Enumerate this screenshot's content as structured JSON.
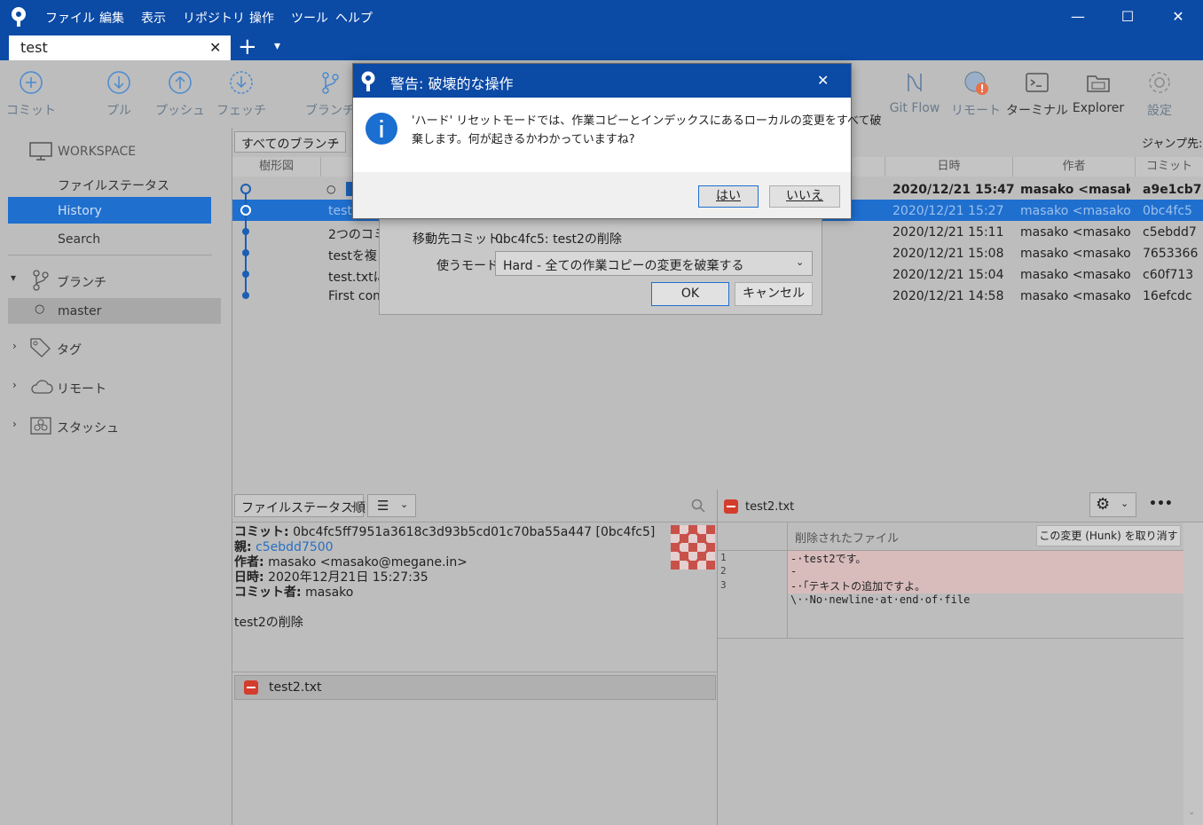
{
  "menubar": {
    "items": [
      "ファイル",
      "編集",
      "表示",
      "リポジトリ",
      "操作",
      "ツール",
      "ヘルプ"
    ]
  },
  "tab": {
    "title": "test",
    "close": "✕",
    "add": "+",
    "dropdown": "▾"
  },
  "window_controls": {
    "minimize": "—",
    "maximize": "☐",
    "close": "✕"
  },
  "toolbar": {
    "commit": "コミット",
    "pull": "プル",
    "push": "プッシュ",
    "fetch": "フェッチ",
    "branch": "ブランチ",
    "gitflow": "Git Flow",
    "remote": "リモート",
    "terminal": "ターミナル",
    "explorer": "Explorer",
    "settings": "設定"
  },
  "sidebar": {
    "workspace": "WORKSPACE",
    "file_status": "ファイルステータス",
    "history": "History",
    "search": "Search",
    "branches": "ブランチ",
    "master": "master",
    "tags": "タグ",
    "remotes": "リモート",
    "stashes": "スタッシュ"
  },
  "history": {
    "branch_filter": "すべてのブランチ",
    "jump_to": "ジャンプ先:",
    "columns": {
      "graph": "樹形図",
      "date": "日時",
      "author": "作者",
      "commit": "コミット"
    },
    "rows": [
      {
        "desc": "",
        "date": "2020/12/21  15:47",
        "author": "masako <masako(",
        "hash": "a9e1cb7"
      },
      {
        "desc": "test",
        "date": "2020/12/21  15:27",
        "author": "masako <masako@",
        "hash": "0bc4fc5"
      },
      {
        "desc": "2つのコミ",
        "date": "2020/12/21  15:11",
        "author": "masako <masako@",
        "hash": "c5ebdd7"
      },
      {
        "desc": "testを複",
        "date": "2020/12/21  15:08",
        "author": "masako <masako@",
        "hash": "7653366"
      },
      {
        "desc": "test.txtに",
        "date": "2020/12/21  15:04",
        "author": "masako <masako@",
        "hash": "c60f713"
      },
      {
        "desc": "First com",
        "date": "2020/12/21  14:58",
        "author": "masako <masako@",
        "hash": "16efcdc"
      }
    ]
  },
  "details": {
    "sort": "ファイルステータス順",
    "commit_label": "コミット:",
    "commit_value": "0bc4fc5ff7951a3618c3d93b5cd01c70ba55a447 [0bc4fc5]",
    "parent_label": "親:",
    "parent_value": "c5ebdd7500",
    "author_label": "作者:",
    "author_value": "masako <masako@megane.in>",
    "date_label": "日時:",
    "date_value": "2020年12月21日 15:27:35",
    "committer_label": "コミット者:",
    "committer_value": "masako",
    "message": "test2の削除",
    "file": "test2.txt"
  },
  "diff": {
    "file": "test2.txt",
    "hunk_title": "削除されたファイル",
    "discard_hunk": "この変更 (Hunk) を取り消す",
    "more": "•••",
    "line_numbers": [
      "1",
      "2",
      "3"
    ],
    "lines": [
      "-·test2です。",
      "-",
      "-·「テキストの追加ですよ。",
      "\\··No·newline·at·end·of·file"
    ]
  },
  "reset_dialog": {
    "target_label": "移動先コミット:",
    "target_value": "0bc4fc5: test2の削除",
    "mode_label": "使うモード:",
    "mode_value": "Hard - 全ての作業コピーの変更を破棄する",
    "ok": "OK",
    "cancel": "キャンセル"
  },
  "warning_dialog": {
    "title": "警告: 破壊的な操作",
    "message_line1": "'ハード' リセットモードでは、作業コピーとインデックスにあるローカルの変更をすべて破",
    "message_line2": "棄します。何が起きるかわかっていますね?",
    "yes": "はい",
    "no": "いいえ",
    "close": "✕"
  }
}
